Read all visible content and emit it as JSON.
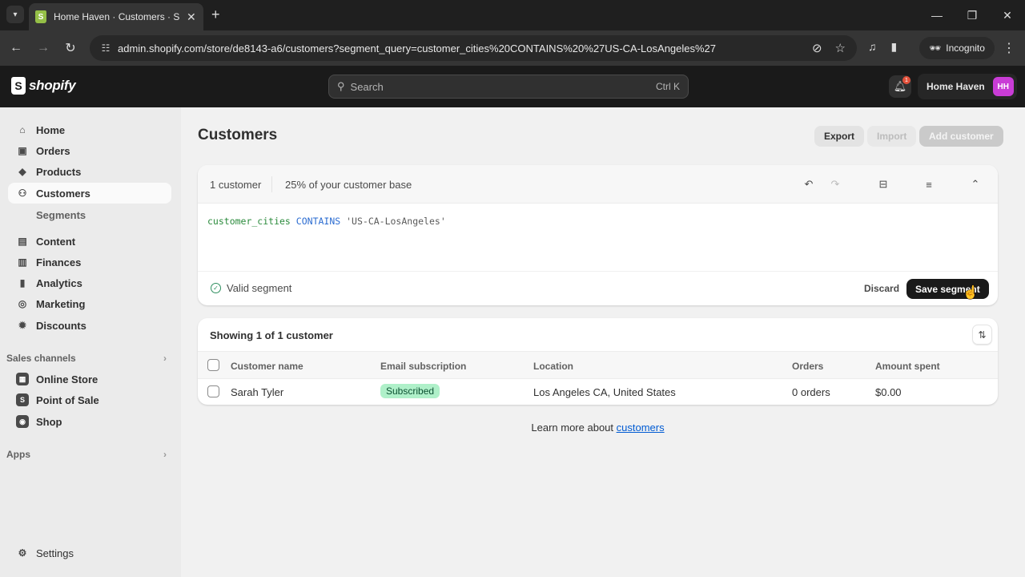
{
  "browser": {
    "tab_title": "Home Haven · Customers · Shopify",
    "url": "admin.shopify.com/store/de8143-a6/customers?segment_query=customer_cities%20CONTAINS%20%27US-CA-LosAngeles%27",
    "profile_label": "Incognito"
  },
  "topbar": {
    "logo_text": "shopify",
    "search_placeholder": "Search",
    "search_shortcut": "Ctrl K",
    "notification_count": "1",
    "store_name": "Home Haven",
    "store_initials": "HH"
  },
  "sidebar": {
    "items": [
      {
        "label": "Home",
        "icon": "home-icon"
      },
      {
        "label": "Orders",
        "icon": "inbox-icon"
      },
      {
        "label": "Products",
        "icon": "tag-icon"
      },
      {
        "label": "Customers",
        "icon": "person-icon",
        "active": true
      },
      {
        "label": "Content",
        "icon": "image-icon"
      },
      {
        "label": "Finances",
        "icon": "bank-icon"
      },
      {
        "label": "Analytics",
        "icon": "bar-chart-icon"
      },
      {
        "label": "Marketing",
        "icon": "target-icon"
      },
      {
        "label": "Discounts",
        "icon": "discount-icon"
      }
    ],
    "sub_item": "Segments",
    "sales_channels_label": "Sales channels",
    "channels": [
      {
        "label": "Online Store",
        "icon": "store-icon"
      },
      {
        "label": "Point of Sale",
        "icon": "pos-icon"
      },
      {
        "label": "Shop",
        "icon": "shop-icon"
      }
    ],
    "apps_label": "Apps",
    "settings_label": "Settings"
  },
  "page": {
    "title": "Customers",
    "buttons": {
      "export": "Export",
      "import": "Import",
      "add_customer": "Add customer"
    }
  },
  "segment": {
    "count": "1 customer",
    "percent": "25% of your customer base",
    "query": {
      "field": "customer_cities",
      "operator": "CONTAINS",
      "value": "'US-CA-LosAngeles'"
    },
    "status": "Valid segment",
    "discard": "Discard",
    "save": "Save segment"
  },
  "table": {
    "heading": "Showing 1 of 1 customer",
    "columns": [
      "Customer name",
      "Email subscription",
      "Location",
      "Orders",
      "Amount spent"
    ],
    "rows": [
      {
        "name": "Sarah Tyler",
        "subscription": "Subscribed",
        "location": "Los Angeles CA, United States",
        "orders": "0 orders",
        "amount": "$0.00"
      }
    ]
  },
  "footer": {
    "learn_prefix": "Learn more about ",
    "learn_link": "customers"
  }
}
